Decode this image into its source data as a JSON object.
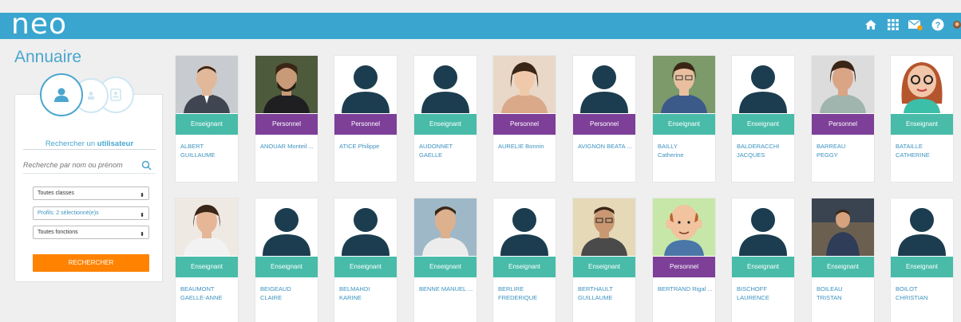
{
  "app": {
    "logo": "neo"
  },
  "page": {
    "title": "Annuaire"
  },
  "search": {
    "title_prefix": "Rechercher un",
    "title_bold": "utilisateur",
    "placeholder": "Recherche par nom ou prénom",
    "select_classes": "Toutes classes",
    "select_profiles": "Profils: 2 sélectionné(e)s",
    "select_functions": "Toutes fonctions",
    "button": "RECHERCHER"
  },
  "topbar_icons": [
    "home-icon",
    "apps-grid-icon",
    "messages-icon",
    "help-icon",
    "user-avatar"
  ],
  "colors": {
    "topbar": "#3aa6cf",
    "enseignant": "#48bba9",
    "personnel": "#7d3f98",
    "button": "#ff8300",
    "link": "#3d93c0"
  },
  "users": [
    {
      "role": "Enseignant",
      "name1": "ALBERT",
      "name2": "GUILLAUME",
      "photo": "man-suit"
    },
    {
      "role": "Personnel",
      "name1": "ANOUAR Monteil ...",
      "name2": "",
      "photo": "man-beard"
    },
    {
      "role": "Personnel",
      "name1": "ATICE Philippe",
      "name2": "",
      "photo": "silhouette"
    },
    {
      "role": "Enseignant",
      "name1": "AUDONNET",
      "name2": "GAELLE",
      "photo": "silhouette"
    },
    {
      "role": "Personnel",
      "name1": "AURELIE Bonnin",
      "name2": "",
      "photo": "woman-blonde"
    },
    {
      "role": "Personnel",
      "name1": "AVIGNON BEATA ...",
      "name2": "",
      "photo": "silhouette"
    },
    {
      "role": "Enseignant",
      "name1": "BAILLY",
      "name2": "Catherine",
      "photo": "woman-glasses"
    },
    {
      "role": "Enseignant",
      "name1": "BALDERACCHI",
      "name2": "JACQUES",
      "photo": "silhouette"
    },
    {
      "role": "Personnel",
      "name1": "BARREAU",
      "name2": "PEGGY",
      "photo": "woman-dark"
    },
    {
      "role": "Enseignant",
      "name1": "BATAILLE",
      "name2": "CATHERINE",
      "photo": "cartoon-woman"
    },
    {
      "role": "Enseignant",
      "name1": "BEAUMONT",
      "name2": "GAELLE-ANNE",
      "photo": "woman-smile"
    },
    {
      "role": "Enseignant",
      "name1": "BEIGEAUD",
      "name2": "CLAIRE",
      "photo": "silhouette"
    },
    {
      "role": "Enseignant",
      "name1": "BELMAHDI",
      "name2": "KARINE",
      "photo": "silhouette"
    },
    {
      "role": "Enseignant",
      "name1": "BENNE MANUEL ...",
      "name2": "",
      "photo": "man-young"
    },
    {
      "role": "Enseignant",
      "name1": "BERLIRE",
      "name2": "FREDERIQUE",
      "photo": "silhouette"
    },
    {
      "role": "Enseignant",
      "name1": "BERTHAULT",
      "name2": "GUILLAUME",
      "photo": "man-glasses"
    },
    {
      "role": "Personnel",
      "name1": "BERTRAND Rigal ...",
      "name2": "",
      "photo": "cartoon-man"
    },
    {
      "role": "Enseignant",
      "name1": "BISCHOFF",
      "name2": "LAURENCE",
      "photo": "silhouette"
    },
    {
      "role": "Enseignant",
      "name1": "BOILEAU",
      "name2": "TRISTAN",
      "photo": "man-sitting"
    },
    {
      "role": "Enseignant",
      "name1": "BOILOT",
      "name2": "CHRISTIAN",
      "photo": "silhouette"
    }
  ]
}
